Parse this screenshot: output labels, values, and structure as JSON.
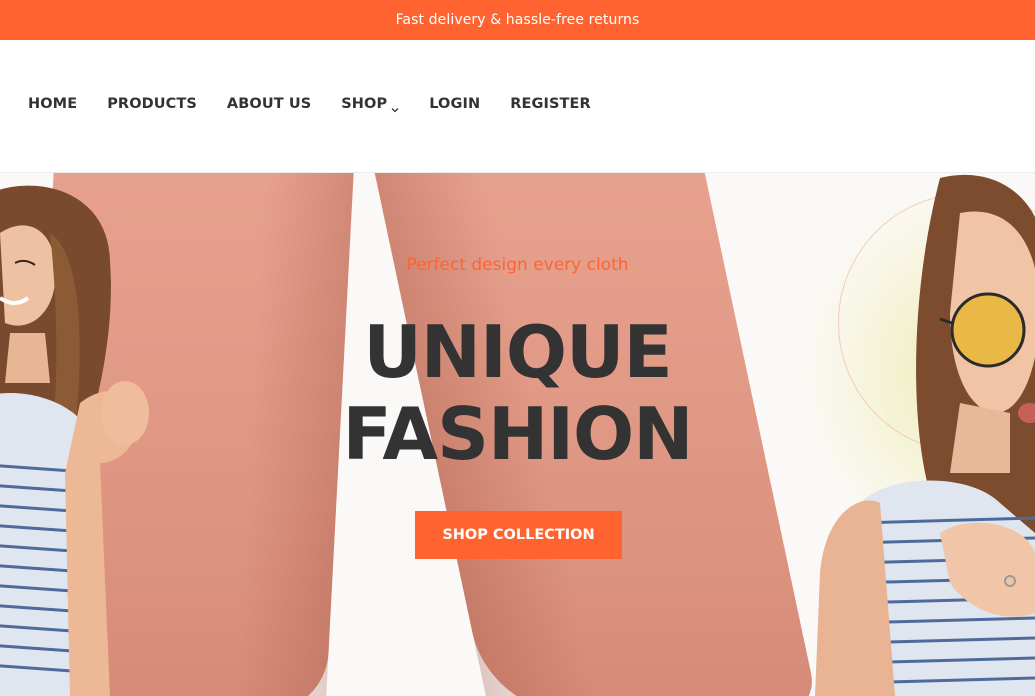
{
  "announcement": {
    "text": "Fast delivery & hassle-free returns"
  },
  "nav": {
    "items": [
      {
        "label": "HOME"
      },
      {
        "label": "PRODUCTS"
      },
      {
        "label": "ABOUT US"
      },
      {
        "label": "SHOP",
        "icon": "chevron-down-icon"
      },
      {
        "label": "LOGIN"
      },
      {
        "label": "REGISTER"
      }
    ]
  },
  "hero": {
    "subtitle": "Perfect design every cloth",
    "headline_line1": "UNIQUE",
    "headline_line2": "FASHION",
    "cta_label": "SHOP COLLECTION"
  },
  "colors": {
    "accent": "#ff6430",
    "text_dark": "#333333",
    "background": "#ffffff"
  }
}
